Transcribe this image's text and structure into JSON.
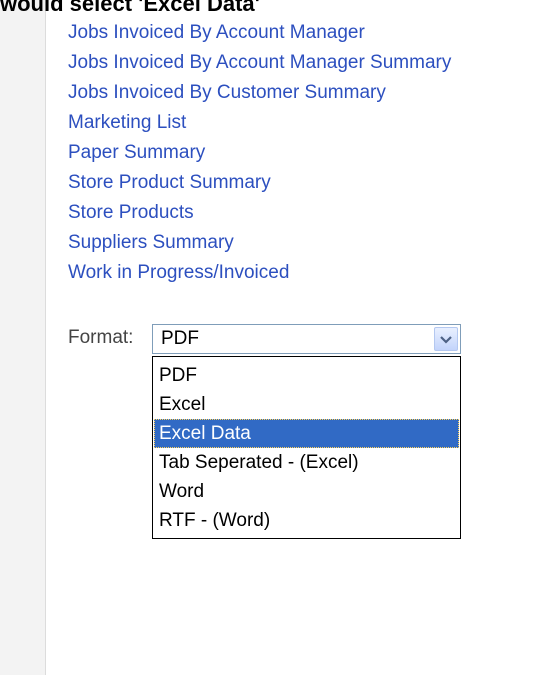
{
  "caption": "would select 'Excel Data'",
  "reports": [
    "Jobs Invoiced By Account Manager",
    "Jobs Invoiced By Account Manager Summary",
    "Jobs Invoiced By Customer Summary",
    "Marketing List",
    "Paper Summary",
    "Store Product Summary",
    "Store Products",
    "Suppliers Summary",
    "Work in Progress/Invoiced"
  ],
  "format": {
    "label": "Format:",
    "selected_value": "PDF",
    "options": [
      "PDF",
      "Excel",
      "Excel Data",
      "Tab Seperated - (Excel)",
      "Word",
      "RTF - (Word)"
    ],
    "highlighted_option": "Excel Data"
  },
  "colors": {
    "link": "#2c4fbf",
    "highlight": "#316ac5"
  },
  "icons": {
    "dropdown_arrow": "chevron-down-icon"
  }
}
